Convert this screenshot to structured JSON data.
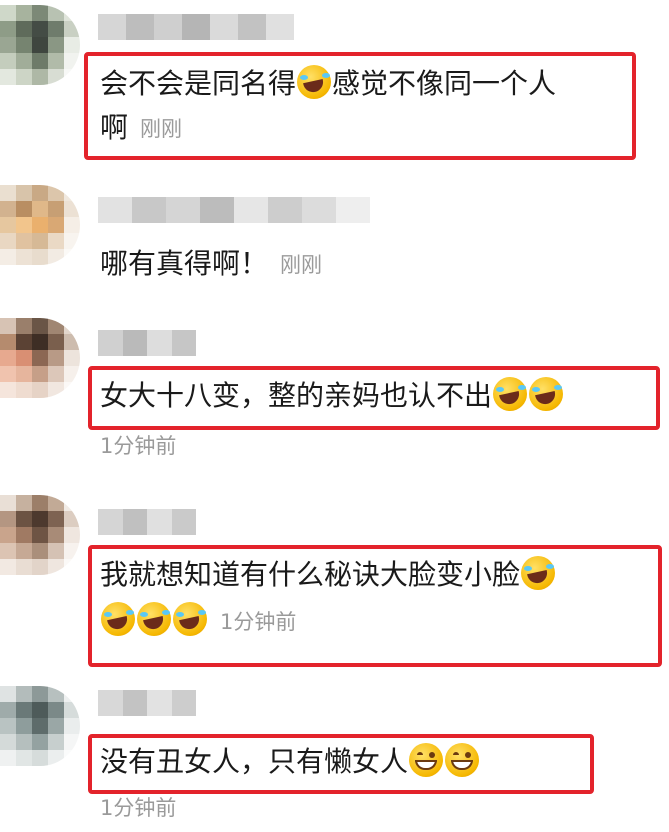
{
  "comments": [
    {
      "text": "会不会是同名得",
      "text_after": "感觉不像同一个人",
      "text_line2": "啊",
      "time": "刚刚",
      "emojis": [
        "laugh-cry-emoji"
      ]
    },
    {
      "text": "哪有真得啊！",
      "time": "刚刚"
    },
    {
      "text": "女大十八变，整的亲妈也认不出",
      "time": "1分钟前",
      "emojis": [
        "laugh-cry-emoji",
        "laugh-cry-emoji"
      ]
    },
    {
      "text": "我就想知道有什么秘诀大脸变小脸",
      "time": "1分钟前",
      "emojis": [
        "laugh-cry-emoji",
        "laugh-cry-emoji",
        "laugh-cry-emoji",
        "laugh-cry-emoji"
      ]
    },
    {
      "text": "没有丑女人，只有懒女人",
      "time": "1分钟前",
      "emojis": [
        "grin-emoji",
        "grin-emoji"
      ]
    }
  ],
  "colors": {
    "highlight_border": "#e3232b",
    "timestamp": "#9a9a9a"
  }
}
